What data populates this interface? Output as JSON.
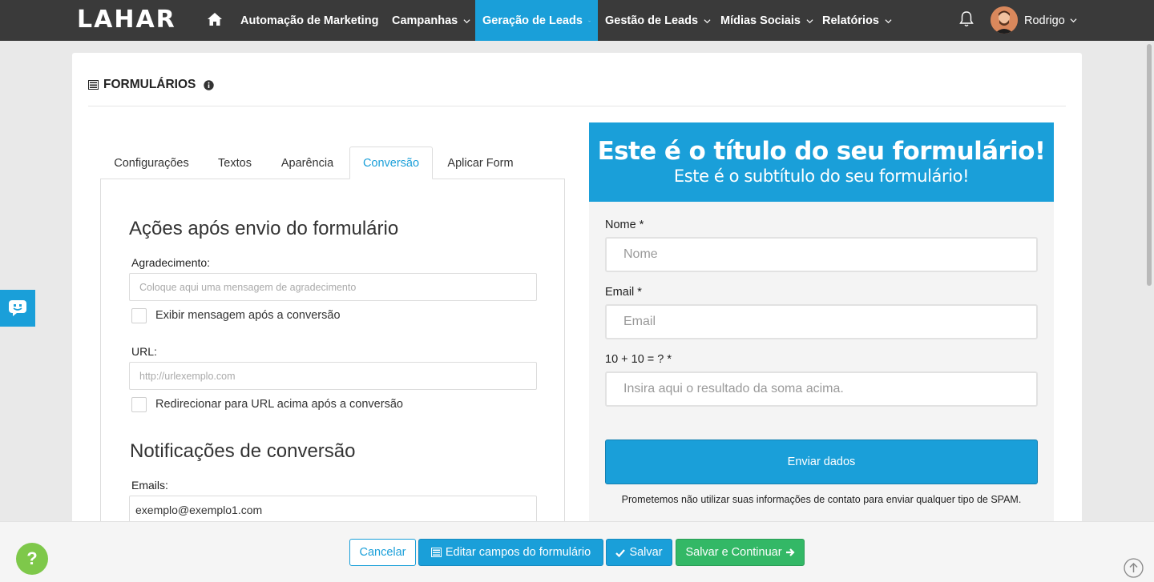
{
  "nav": {
    "logo": "LAHAR",
    "items": [
      {
        "label": "Automação de Marketing",
        "dropdown": false
      },
      {
        "label": "Campanhas",
        "dropdown": true
      },
      {
        "label": "Geração de Leads",
        "dropdown": true,
        "active": true
      },
      {
        "label": "Gestão de Leads",
        "dropdown": true
      },
      {
        "label": "Mídias Sociais",
        "dropdown": true
      },
      {
        "label": "Relatórios",
        "dropdown": true
      }
    ],
    "user_name": "Rodrigo",
    "icons": {
      "home": "home-icon",
      "notifications": "bell-icon",
      "user_menu": "chevron-down-icon"
    }
  },
  "page": {
    "title": "FORMULÁRIOS",
    "title_icon": "list-icon",
    "info_icon": "info-icon"
  },
  "tabs": [
    {
      "label": "Configurações",
      "active": false
    },
    {
      "label": "Textos",
      "active": false
    },
    {
      "label": "Aparência",
      "active": false
    },
    {
      "label": "Conversão",
      "active": true
    },
    {
      "label": "Aplicar Form",
      "active": false
    }
  ],
  "conversion": {
    "actions_title": "Ações após envio do formulário",
    "thanks_label": "Agradecimento:",
    "thanks_placeholder": "Coloque aqui uma mensagem de agradecimento",
    "thanks_value": "",
    "show_message_label": "Exibir mensagem após a conversão",
    "show_message_checked": false,
    "url_label": "URL:",
    "url_placeholder": "http://urlexemplo.com",
    "url_value": "",
    "redirect_label": "Redirecionar para URL acima após a conversão",
    "redirect_checked": false,
    "notifications_title": "Notificações de conversão",
    "emails_label": "Emails:",
    "emails_value": "exemplo@exemplo1.com"
  },
  "preview": {
    "title": "Este é o título do seu formulário!",
    "subtitle": "Este é o subtítulo do seu formulário!",
    "fields": [
      {
        "label": "Nome *",
        "placeholder": "Nome"
      },
      {
        "label": "Email *",
        "placeholder": "Email"
      },
      {
        "label": "10 + 10 = ? *",
        "placeholder": "Insira aqui o resultado da soma acima."
      }
    ],
    "submit_label": "Enviar dados",
    "privacy_text": "Prometemos não utilizar suas informações de contato para enviar qualquer tipo de SPAM."
  },
  "actions": {
    "cancel": "Cancelar",
    "edit_fields": "Editar campos do formulário",
    "save": "Salvar",
    "save_continue": "Salvar e Continuar"
  },
  "widgets": {
    "help": "?"
  },
  "colors": {
    "nav_bg": "#3a3a3a",
    "accent": "#1a9fd9",
    "success": "#33b866",
    "help_widget": "#7ec84a"
  }
}
